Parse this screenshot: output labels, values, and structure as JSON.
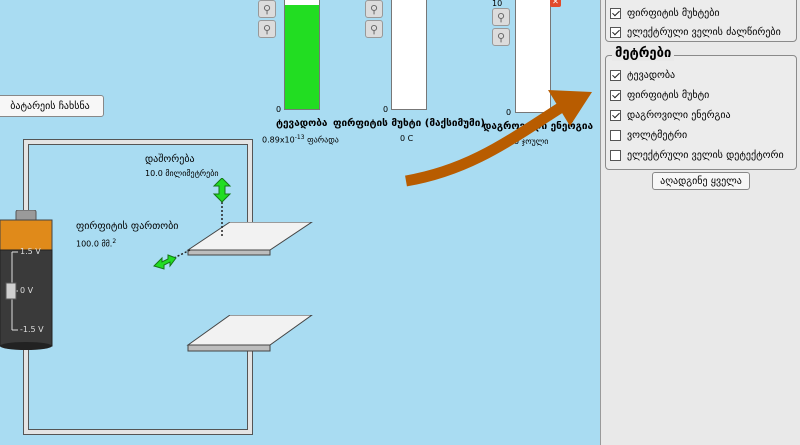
{
  "sim": {
    "battery_button": "ბატარეის ჩახსნა",
    "separation": {
      "label": "დაშორება",
      "value": "10.0 მილიმეტრები"
    },
    "plate_area": {
      "label": "ფირფიტის ფართობი",
      "value": "100.0 მმ.",
      "exp": "2"
    },
    "battery": {
      "top": "1.5 V",
      "mid": "0 V",
      "bottom": "-1.5 V"
    },
    "meters": [
      {
        "label": "ტევადობა",
        "value": "0.89x10",
        "exp": "-13",
        "unit": "ფარადა",
        "zero": "0",
        "fill_fraction": 0.95
      },
      {
        "label": "ფირფიტის მუხტი (მაქსიმუმი)",
        "value": "0 C",
        "zero": "0",
        "fill_fraction": 0
      },
      {
        "label": "დაგროვილი ენერგია",
        "value": "0 ჯოული",
        "zero": "0",
        "top_value": "10",
        "fill_fraction": 0
      }
    ]
  },
  "panel": {
    "top_group": {
      "items": [
        {
          "label": "ფირფიტის მუხტები",
          "checked": true
        },
        {
          "label": "ელექტრული ველის ძალწირები",
          "checked": true
        }
      ]
    },
    "meters_group": {
      "title": "მეტრები",
      "items": [
        {
          "label": "ტევადობა",
          "checked": true
        },
        {
          "label": "ფირფიტის მუხტი",
          "checked": true
        },
        {
          "label": "დაგროვილი ენერგია",
          "checked": true
        },
        {
          "label": "ვოლტმეტრი",
          "checked": false
        },
        {
          "label": "ელექტრული ველის დეტექტორი",
          "checked": false
        }
      ]
    },
    "reset_button": "აღადგინე ყველა"
  },
  "colors": {
    "background": "#a9dcf2",
    "meter_fill": "#22dd22",
    "arrow": "#b85c00",
    "wire": "#e4e4e4"
  }
}
